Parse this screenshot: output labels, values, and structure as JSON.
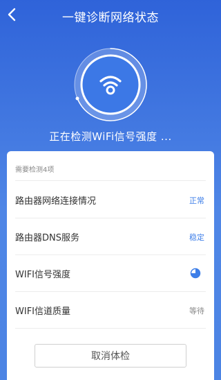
{
  "header": {
    "title": "一键诊断网络状态",
    "back_icon": "chevron-left-icon"
  },
  "scan": {
    "icon": "wifi-icon",
    "status_text": "正在检测WiFi信号强度 ..."
  },
  "checklist": {
    "header": "需要检测4项",
    "items": [
      {
        "label": "路由器网络连接情况",
        "status": "正常",
        "state": "done"
      },
      {
        "label": "路由器DNS服务",
        "status": "稳定",
        "state": "done"
      },
      {
        "label": "WIFI信号强度",
        "status": "",
        "state": "in-progress",
        "icon": "progress-pie-icon"
      },
      {
        "label": "WIFI信道质量",
        "status": "等待",
        "state": "waiting"
      }
    ],
    "cancel_label": "取消体检"
  },
  "colors": {
    "background_top": "#2f63d9",
    "background_bottom": "#4c84e4",
    "accent": "#3d7ee8",
    "muted": "#888888"
  }
}
